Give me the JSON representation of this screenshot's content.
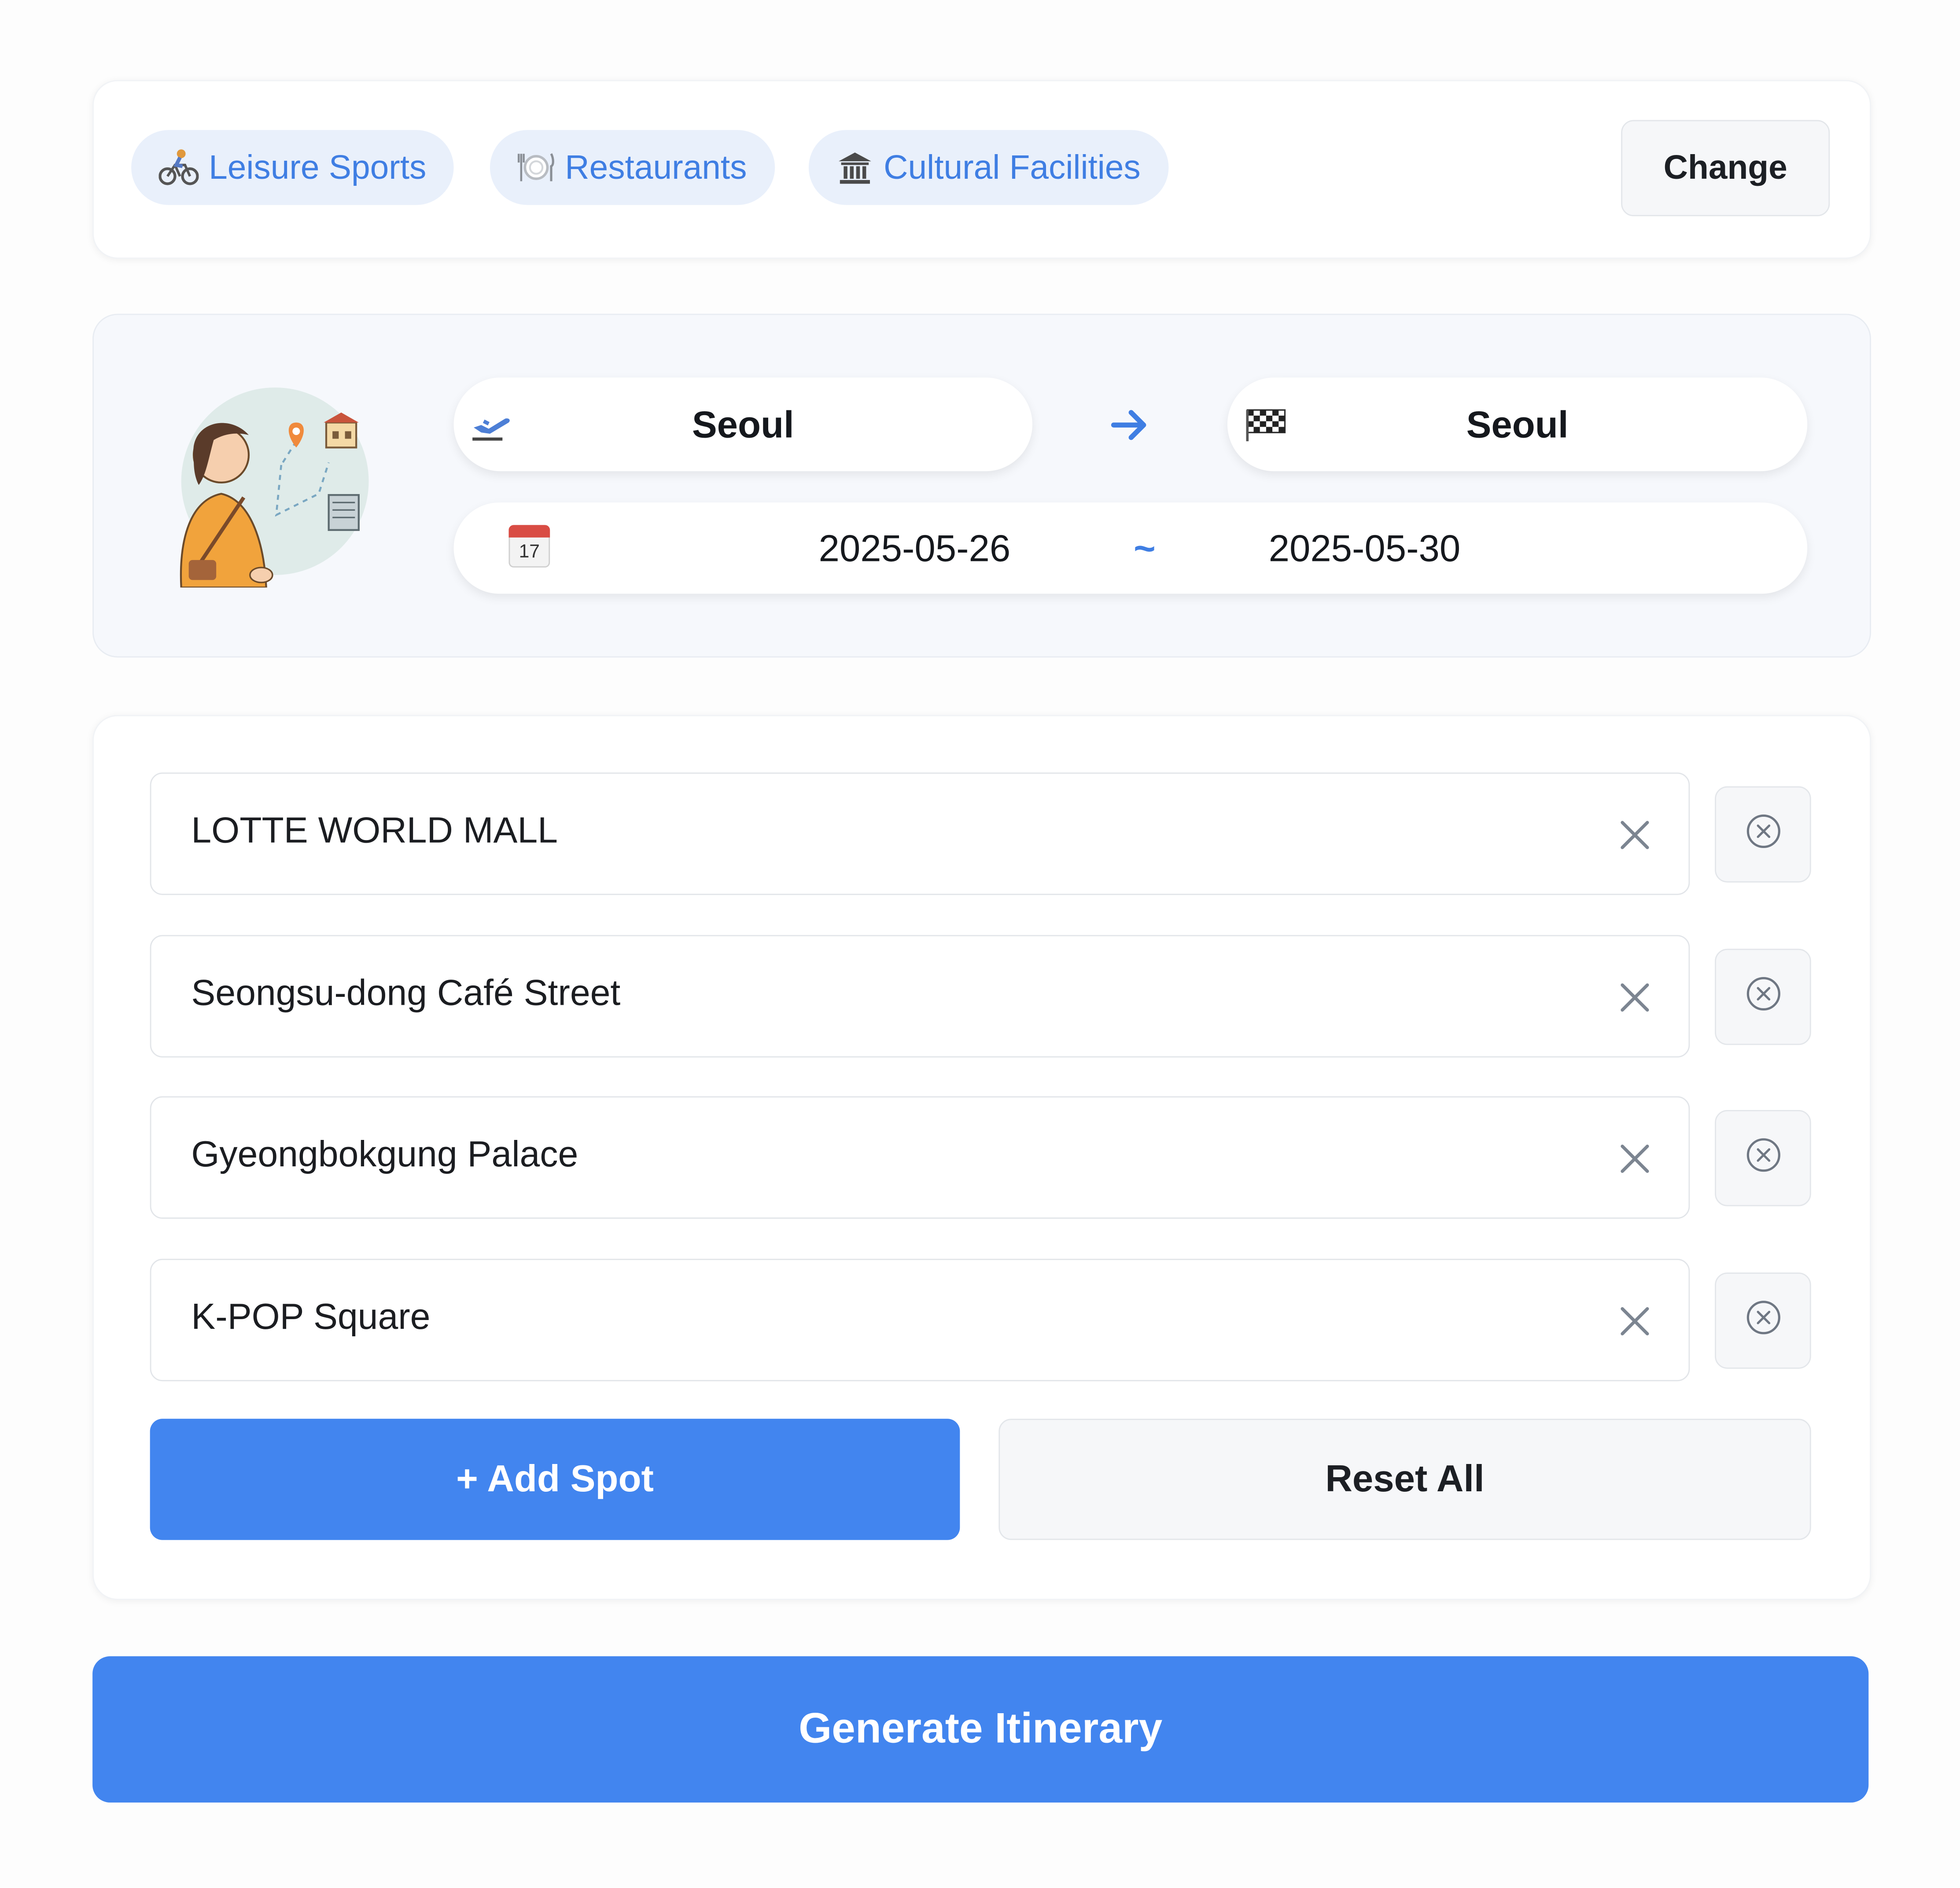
{
  "categories": [
    {
      "label": "Leisure Sports",
      "icon": "cyclist-icon"
    },
    {
      "label": "Restaurants",
      "icon": "plate-cutlery-icon"
    },
    {
      "label": "Cultural Facilities",
      "icon": "museum-icon"
    }
  ],
  "change_label": "Change",
  "route": {
    "origin": "Seoul",
    "origin_icon": "airplane-departure-icon",
    "arrow_icon": "arrow-right-icon",
    "destination": "Seoul",
    "destination_icon": "checkered-flag-icon",
    "calendar_icon": "calendar-icon",
    "calendar_day": "17",
    "start_date": "2025-05-26",
    "date_separator": "~",
    "end_date": "2025-05-30"
  },
  "spots": [
    {
      "name": "LOTTE WORLD MALL"
    },
    {
      "name": "Seongsu-dong Café Street"
    },
    {
      "name": "Gyeongbokgung Palace"
    },
    {
      "name": "K-POP Square"
    }
  ],
  "add_spot_label": "+ Add Spot",
  "reset_all_label": "Reset All",
  "generate_label": "Generate Itinerary",
  "colors": {
    "accent": "#4285ef",
    "tag_bg": "#e9f0fb",
    "tag_text": "#3f7ee3"
  }
}
